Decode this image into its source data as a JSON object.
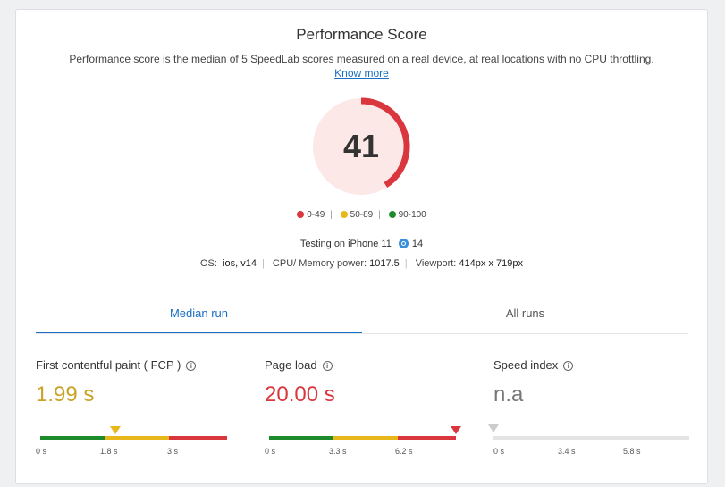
{
  "header": {
    "title": "Performance Score",
    "description": "Performance score is the median of 5 SpeedLab scores measured on a real device, at real locations with no CPU throttling.",
    "know_more": "Know more"
  },
  "score": {
    "value": "41",
    "fraction": 0.41,
    "color": "#d9363e",
    "bg": "#fde8e8"
  },
  "legend": [
    {
      "label": "0-49",
      "color": "#d9363e"
    },
    {
      "label": "50-89",
      "color": "#e8b81a"
    },
    {
      "label": "90-100",
      "color": "#1d8a2c"
    }
  ],
  "device": {
    "testing_label": "Testing on iPhone 11",
    "ios_version": "14"
  },
  "meta": {
    "os_label": "OS:",
    "os_value": "ios, v14",
    "cpu_label": "CPU/ Memory power:",
    "cpu_value": "1017.5",
    "viewport_label": "Viewport:",
    "viewport_value": "414px x 719px"
  },
  "tabs": [
    {
      "label": "Median run",
      "active": true
    },
    {
      "label": "All runs",
      "active": false
    }
  ],
  "metrics": [
    {
      "label": "First contentful paint ( FCP )",
      "value": "1.99 s",
      "value_color": "#c9a227",
      "ticks": [
        "0 s",
        "1.8 s",
        "3 s"
      ],
      "marker_color": "#e8b81a"
    },
    {
      "label": "Page load",
      "value": "20.00 s",
      "value_color": "#d9363e",
      "ticks": [
        "0 s",
        "3.3 s",
        "6.2 s"
      ],
      "marker_color": "#d9363e"
    },
    {
      "label": "Speed index",
      "value": "n.a",
      "value_color": "#777",
      "ticks": [
        "0 s",
        "3.4 s",
        "5.8 s"
      ],
      "marker_color": "#cccccc"
    }
  ]
}
